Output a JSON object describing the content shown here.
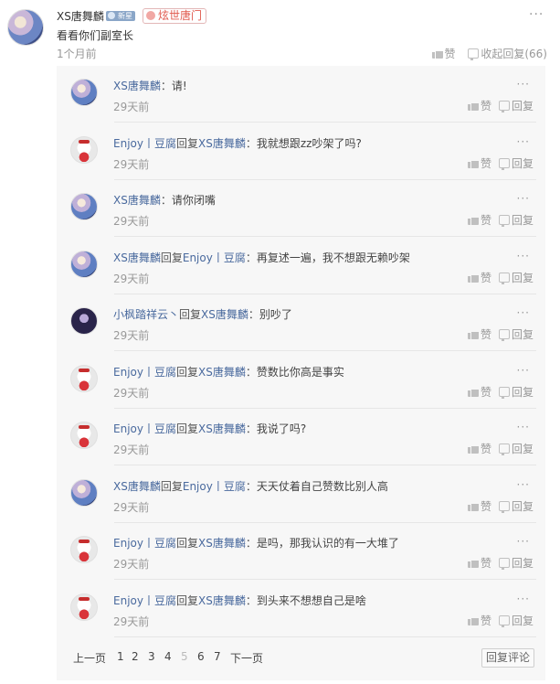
{
  "post": {
    "author": "XS唐舞麟",
    "level_badge": "新星",
    "group_tag": "炫世唐门",
    "more": "···",
    "text": "看看你们副室长",
    "time": "1个月前",
    "like_label": "赞",
    "collapse_label": "收起回复(66)"
  },
  "replies": [
    {
      "avatar": "xs",
      "user": "XS唐舞麟",
      "reply_word": "",
      "target": "",
      "text": "请!",
      "time": "29天前"
    },
    {
      "avatar": "enjoy",
      "user": "Enjoy丨豆腐",
      "reply_word": "回复",
      "target": "XS唐舞麟",
      "text": "我就想跟zz吵架了吗?",
      "time": "29天前"
    },
    {
      "avatar": "xs",
      "user": "XS唐舞麟",
      "reply_word": "",
      "target": "",
      "text": "请你闭嘴",
      "time": "29天前"
    },
    {
      "avatar": "xs",
      "user": "XS唐舞麟",
      "reply_word": "回复",
      "target": "Enjoy丨豆腐",
      "text": "再复述一遍，我不想跟无赖吵架",
      "time": "29天前"
    },
    {
      "avatar": "xf",
      "user": "小枫踏祥云丶",
      "reply_word": "回复",
      "target": "XS唐舞麟",
      "text": "别吵了",
      "time": "29天前"
    },
    {
      "avatar": "enjoy",
      "user": "Enjoy丨豆腐",
      "reply_word": "回复",
      "target": "XS唐舞麟",
      "text": "赞数比你高是事实",
      "time": "29天前"
    },
    {
      "avatar": "enjoy",
      "user": "Enjoy丨豆腐",
      "reply_word": "回复",
      "target": "XS唐舞麟",
      "text": "我说了吗?",
      "time": "29天前"
    },
    {
      "avatar": "xs",
      "user": "XS唐舞麟",
      "reply_word": "回复",
      "target": "Enjoy丨豆腐",
      "text": "天天仗着自己赞数比别人高",
      "time": "29天前"
    },
    {
      "avatar": "enjoy",
      "user": "Enjoy丨豆腐",
      "reply_word": "回复",
      "target": "XS唐舞麟",
      "text": "是吗，那我认识的有一大堆了",
      "time": "29天前"
    },
    {
      "avatar": "enjoy",
      "user": "Enjoy丨豆腐",
      "reply_word": "回复",
      "target": "XS唐舞麟",
      "text": "到头来不想想自己是啥",
      "time": "29天前"
    }
  ],
  "reply_actions": {
    "more": "···",
    "like": "赞",
    "reply": "回复",
    "colon": "："
  },
  "pagination": {
    "prev": "上一页",
    "pages": [
      "1",
      "2",
      "3",
      "4",
      "5",
      "6",
      "7"
    ],
    "current": "5",
    "next": "下一页",
    "reply_button": "回复评论"
  },
  "icons": {
    "like": "thumb-up-icon",
    "reply": "reply-icon",
    "more": "more-dots-icon"
  },
  "colors": {
    "username": "#4a6a9e",
    "tag_text": "#e05a4e",
    "muted": "#999999",
    "panel_bg": "#f7f7f7"
  }
}
